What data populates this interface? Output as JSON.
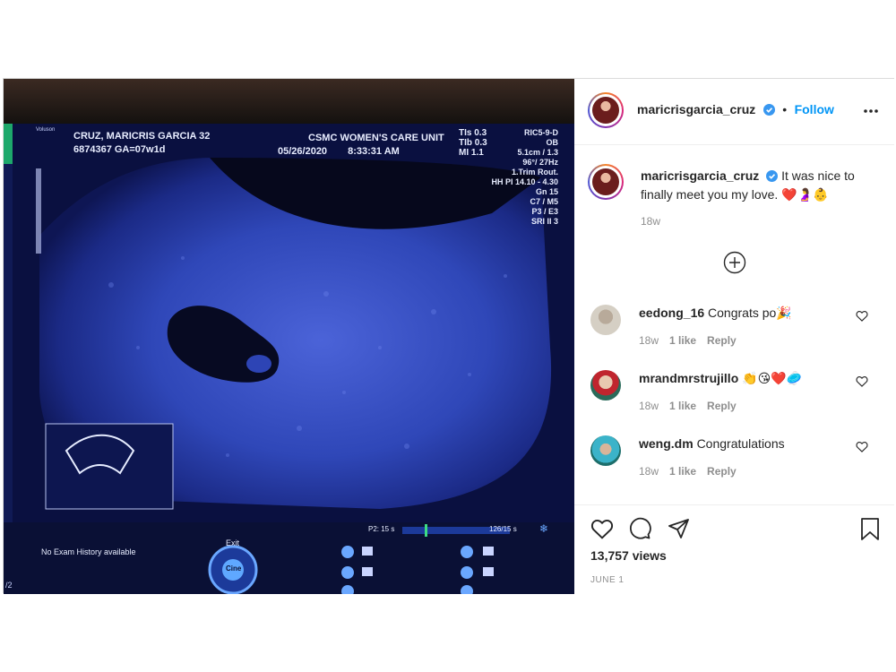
{
  "post": {
    "username": "maricrisgarcia_cruz",
    "follow_label": "Follow",
    "separator": "•",
    "caption": "It was nice to finally meet you my love.",
    "caption_emojis": "❤️🤰👶",
    "caption_time": "18w",
    "views": "13,757 views",
    "date": "JUNE 1"
  },
  "ultrasound": {
    "patient": "CRUZ, MARICRIS GARCIA  32",
    "id_line": "6874367  GA=07w1d",
    "unit": "CSMC WOMEN'S CARE UNIT",
    "date": "05/26/2020",
    "time": "8:33:31 AM",
    "tis": "TIs  0.3",
    "tib": "TIb  0.3",
    "mi": "MI  1.1",
    "probe": "RIC5-9-D",
    "mode": "OB",
    "params": [
      "5.1cm / 1.3",
      "96°/ 27Hz",
      "1.Trim Rout.",
      "HH PI 14.10 - 4.30",
      "Gn  15",
      "C7 / M5",
      "P3 / E3",
      "SRI II 3"
    ],
    "no_history": "No Exam History available",
    "exit": "Exit",
    "cine": "Cine",
    "p2": "P2: 15 s",
    "frames": "126/15 s",
    "brand": "Voluson",
    "page": "/2"
  },
  "comments": [
    {
      "user": "eedong_16",
      "text": "Congrats po",
      "emoji": "🎉",
      "time": "18w",
      "likes": "1 like",
      "reply": "Reply"
    },
    {
      "user": "mrandmrstrujillo",
      "text": "",
      "emoji": "👏😘❤️🥏",
      "time": "18w",
      "likes": "1 like",
      "reply": "Reply"
    },
    {
      "user": "weng.dm",
      "text": "Congratulations",
      "emoji": "",
      "time": "18w",
      "likes": "1 like",
      "reply": "Reply"
    }
  ],
  "icons": [
    "verified-icon",
    "more-options-icon",
    "load-more-comments-icon",
    "like-icon",
    "comment-icon",
    "share-icon",
    "save-icon"
  ],
  "colors": {
    "accent": "#0095f6",
    "text": "#262626",
    "muted": "#8e8e8e",
    "like_red": "#ed4956"
  }
}
